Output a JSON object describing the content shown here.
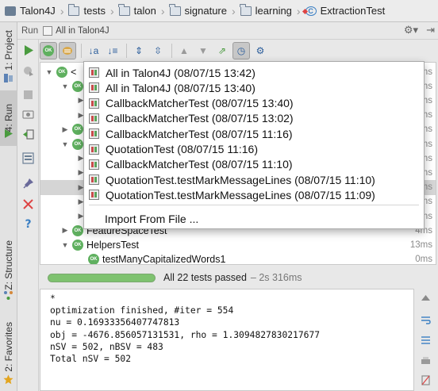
{
  "breadcrumb": [
    {
      "label": "Talon4J",
      "icon": "project-icon"
    },
    {
      "label": "tests",
      "icon": "folder-icon"
    },
    {
      "label": "talon",
      "icon": "folder-icon"
    },
    {
      "label": "signature",
      "icon": "folder-icon"
    },
    {
      "label": "learning",
      "icon": "folder-icon"
    },
    {
      "label": "ExtractionTest",
      "icon": "class-icon"
    }
  ],
  "side_tabs": {
    "project": "1: Project",
    "run": "4: Run",
    "structure": "Z: Structure",
    "favorites": "2: Favorites"
  },
  "run_header": {
    "label": "Run",
    "tab_title": "All in Talon4J"
  },
  "tree": {
    "rows": [
      {
        "name": "<",
        "time": "ms",
        "level": 0,
        "expanded": true
      },
      {
        "name": "",
        "time": "ms",
        "level": 1,
        "expanded": true
      },
      {
        "name": "",
        "time": "ms",
        "level": 2,
        "expanded": false
      },
      {
        "name": "",
        "time": "ms",
        "level": 2,
        "expanded": false
      },
      {
        "name": "",
        "time": "ms",
        "level": 1,
        "expanded": false
      },
      {
        "name": "",
        "time": "ms",
        "level": 1,
        "expanded": true
      },
      {
        "name": "",
        "time": "ms",
        "level": 2,
        "expanded": false
      },
      {
        "name": "",
        "time": "ms",
        "level": 2,
        "expanded": false
      },
      {
        "name": "",
        "time": "ms",
        "level": 2,
        "expanded": false,
        "selected": true
      },
      {
        "name": "",
        "time": "ms",
        "level": 2,
        "expanded": false
      },
      {
        "name": "",
        "time": "ms",
        "level": 2,
        "expanded": false
      },
      {
        "name": "FeatureSpaceTest",
        "time": "4ms",
        "level": 1,
        "expanded": false
      },
      {
        "name": "HelpersTest",
        "time": "13ms",
        "level": 1,
        "expanded": true
      },
      {
        "name": "testManyCapitalizedWords1",
        "time": "0ms",
        "level": 2,
        "expanded": null
      }
    ]
  },
  "status": {
    "text": "All 22 tests passed",
    "duration": "– 2s 316ms",
    "progress": 1.0,
    "color": "#7ec26f"
  },
  "console": {
    "lines": [
      "*",
      "optimization finished, #iter = 554",
      "nu = 0.16933356407747813",
      "obj = -4676.856057131531, rho = 1.3094827830217677",
      "nSV = 502, nBSV = 483",
      "Total nSV = 502"
    ]
  },
  "history_popup": {
    "items": [
      "All in Talon4J (08/07/15 13:42)",
      "All in Talon4J (08/07/15 13:40)",
      "CallbackMatcherTest (08/07/15 13:40)",
      "CallbackMatcherTest (08/07/15 13:02)",
      "CallbackMatcherTest (08/07/15 11:16)",
      "QuotationTest (08/07/15 11:16)",
      "CallbackMatcherTest (08/07/15 11:10)",
      "QuotationTest.testMarkMessageLines (08/07/15 11:10)",
      "QuotationTest.testMarkMessageLines (08/07/15 11:09)"
    ],
    "import_label": "Import From File ..."
  },
  "badges": {
    "ok": "OK"
  },
  "colors": {
    "pass_green": "#5fb05f",
    "accent_blue": "#2b5d9b",
    "error_red": "#d44"
  }
}
